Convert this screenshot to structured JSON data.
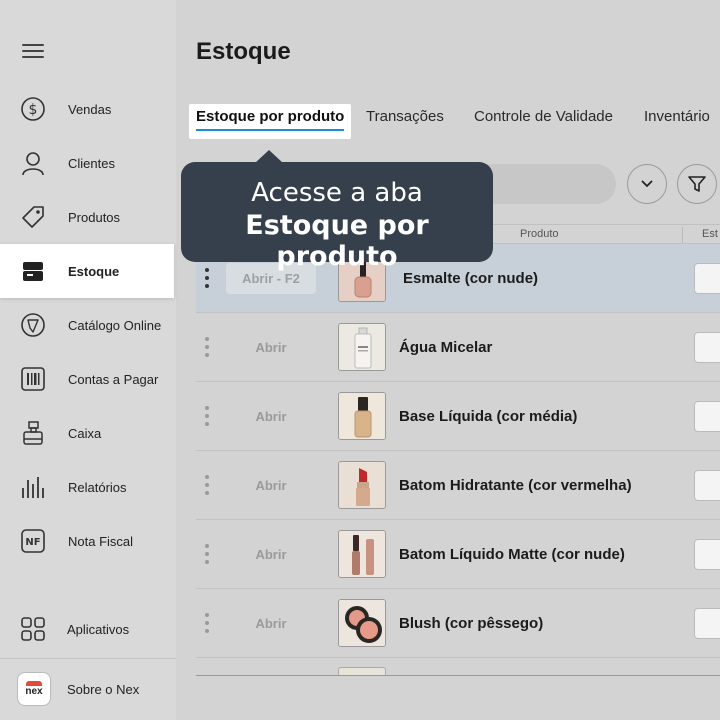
{
  "sidebar": {
    "menu_icon": "hamburger-menu-icon",
    "items": [
      {
        "label": "Vendas",
        "icon": "dollar-coin-icon",
        "active": false
      },
      {
        "label": "Clientes",
        "icon": "user-icon",
        "active": false
      },
      {
        "label": "Produtos",
        "icon": "tag-icon",
        "active": false
      },
      {
        "label": "Estoque",
        "icon": "box-icon",
        "active": true
      },
      {
        "label": "Catálogo Online",
        "icon": "catalog-icon",
        "active": false
      },
      {
        "label": "Contas a Pagar",
        "icon": "barcode-icon",
        "active": false
      },
      {
        "label": "Caixa",
        "icon": "cash-register-icon",
        "active": false
      },
      {
        "label": "Relatórios",
        "icon": "bar-chart-icon",
        "active": false
      },
      {
        "label": "Nota Fiscal",
        "icon": "nf-icon",
        "active": false
      }
    ],
    "apps_label": "Aplicativos",
    "about_label": "Sobre o Nex",
    "logo_text": "nex"
  },
  "header": {
    "title": "Estoque"
  },
  "tabs": [
    {
      "label": "Estoque por produto",
      "active": true
    },
    {
      "label": "Transações",
      "active": false
    },
    {
      "label": "Controle de Validade",
      "active": false
    },
    {
      "label": "Inventário",
      "active": false
    }
  ],
  "table": {
    "columns": {
      "product": "Produto",
      "stock": "Est"
    },
    "rows": [
      {
        "open_label": "Abrir - F2",
        "name": "Esmalte (cor nude)",
        "image": "nail-polish",
        "highlighted": true
      },
      {
        "open_label": "Abrir",
        "name": "Água Micelar",
        "image": "micellar-water",
        "highlighted": false
      },
      {
        "open_label": "Abrir",
        "name": "Base Líquida (cor média)",
        "image": "liquid-foundation",
        "highlighted": false
      },
      {
        "open_label": "Abrir",
        "name": "Batom Hidratante (cor vermelha)",
        "image": "lipstick-red",
        "highlighted": false
      },
      {
        "open_label": "Abrir",
        "name": "Batom Líquido Matte (cor nude)",
        "image": "liquid-lipstick",
        "highlighted": false
      },
      {
        "open_label": "Abrir",
        "name": "Blush (cor pêssego)",
        "image": "blush-compact",
        "highlighted": false
      }
    ]
  },
  "tooltip": {
    "line1": "Acesse a aba",
    "line2": "Estoque por produto"
  },
  "colors": {
    "accent": "#1a8fd6",
    "tooltip_bg": "#36404c",
    "highlight_row": "#c7d0d8"
  }
}
